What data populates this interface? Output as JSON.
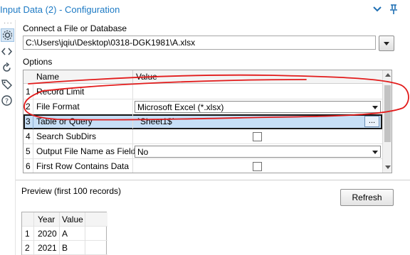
{
  "window": {
    "title": "Input Data (2) - Configuration"
  },
  "connect": {
    "label": "Connect a File or Database",
    "path": "C:\\Users\\jqiu\\Desktop\\0318-DGK1981\\A.xlsx"
  },
  "options": {
    "label": "Options",
    "columns": {
      "name": "Name",
      "value": "Value"
    },
    "rows": [
      {
        "num": "1",
        "name": "Record Limit",
        "value": ""
      },
      {
        "num": "2",
        "name": "File Format",
        "value": "Microsoft Excel (*.xlsx)"
      },
      {
        "num": "3",
        "name": "Table or Query",
        "value": "`Sheet1$`",
        "button": "..."
      },
      {
        "num": "4",
        "name": "Search SubDirs",
        "checked": false
      },
      {
        "num": "5",
        "name": "Output File Name as Field",
        "value": "No"
      },
      {
        "num": "6",
        "name": "First Row Contains Data",
        "checked": false
      }
    ]
  },
  "preview": {
    "label": "Preview (first 100 records)",
    "refresh_label": "Refresh",
    "columns": [
      "Year",
      "Value"
    ],
    "rows": [
      {
        "num": "1",
        "cells": [
          "2020",
          "A"
        ]
      },
      {
        "num": "2",
        "cells": [
          "2021",
          "B"
        ]
      }
    ]
  },
  "icons": {
    "title_bar": [
      "chevron-down-icon",
      "pin-icon"
    ],
    "sidebar": [
      "gear-icon",
      "code-icon",
      "refresh-icon",
      "tag-icon",
      "help-icon"
    ]
  },
  "colors": {
    "title": "#1d7ac4",
    "selected_row": "#c7dff6",
    "annotation": "#e21b1b"
  }
}
